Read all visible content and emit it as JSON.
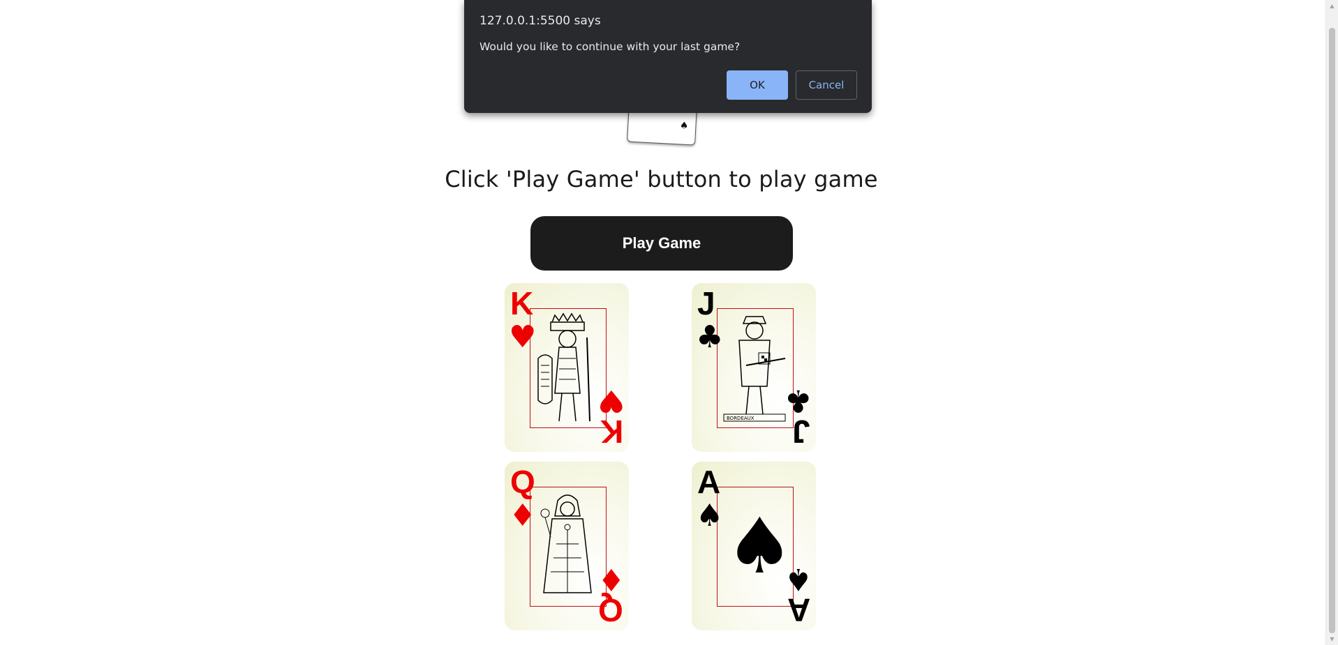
{
  "dialog": {
    "origin": "127.0.0.1:5500 says",
    "message": "Would you like to continue with your last game?",
    "ok_label": "OK",
    "cancel_label": "Cancel"
  },
  "instruction": "Click 'Play Game' button to play game",
  "play_button_label": "Play Game",
  "cards": [
    {
      "rank": "K",
      "suit": "♥",
      "color": "#ee0000"
    },
    {
      "rank": "J",
      "suit": "♣",
      "color": "#000000"
    },
    {
      "rank": "Q",
      "suit": "♦",
      "color": "#ee0000"
    },
    {
      "rank": "A",
      "suit": "♠",
      "color": "#000000"
    }
  ],
  "colors": {
    "dialog_bg": "#292a2d",
    "dialog_accent": "#8ab4f8",
    "button_bg": "#1c1c1c"
  }
}
